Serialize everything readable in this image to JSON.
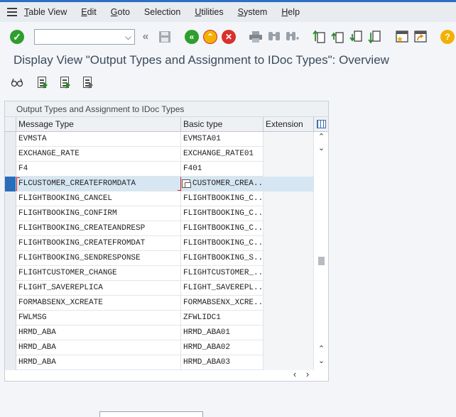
{
  "menubar": {
    "items": [
      {
        "label": "Table View",
        "key": "T",
        "rest": "able View"
      },
      {
        "label": "Edit",
        "key": "E",
        "rest": "dit"
      },
      {
        "label": "Goto",
        "key": "G",
        "rest": "oto"
      },
      {
        "label": "Selection",
        "key": "",
        "rest": "Selection"
      },
      {
        "label": "Utilities",
        "key": "U",
        "rest": "tilities"
      },
      {
        "label": "System",
        "key": "S",
        "rest": "ystem"
      },
      {
        "label": "Help",
        "key": "H",
        "rest": "elp"
      }
    ]
  },
  "toolbar": {
    "command_field_value": "",
    "dropdown_glyph": "⌵",
    "ok_glyph": "✓",
    "back_glyph": "«",
    "save_glyph": "🖫",
    "back2_glyph": "«",
    "exit_glyph": "⌃",
    "cancel_glyph": "✕",
    "print_glyph": "⎙",
    "find_glyph": "⚲",
    "find_next_glyph": "⚲",
    "help_glyph": "?"
  },
  "title": "Display View \"Output Types and Assignment to IDoc Types\": Overview",
  "table": {
    "title": "Output Types and Assignment to IDoc Types",
    "columns": {
      "message_type": "Message Type",
      "basic_type": "Basic type",
      "extension": "Extension"
    },
    "rows": [
      {
        "message_type": "EVMSTA",
        "basic_type": "EVMSTA01",
        "extension": ""
      },
      {
        "message_type": "EXCHANGE_RATE",
        "basic_type": "EXCHANGE_RATE01",
        "extension": ""
      },
      {
        "message_type": "F4",
        "basic_type": "F401",
        "extension": ""
      },
      {
        "message_type": "FLCUSTOMER_CREATEFROMDATA",
        "basic_type": "CUSTOMER_CREA...",
        "extension": "",
        "selected": true
      },
      {
        "message_type": "FLIGHTBOOKING_CANCEL",
        "basic_type": "FLIGHTBOOKING_C...",
        "extension": ""
      },
      {
        "message_type": "FLIGHTBOOKING_CONFIRM",
        "basic_type": "FLIGHTBOOKING_C...",
        "extension": ""
      },
      {
        "message_type": "FLIGHTBOOKING_CREATEANDRESP",
        "basic_type": "FLIGHTBOOKING_C...",
        "extension": ""
      },
      {
        "message_type": "FLIGHTBOOKING_CREATEFROMDAT",
        "basic_type": "FLIGHTBOOKING_C...",
        "extension": ""
      },
      {
        "message_type": "FLIGHTBOOKING_SENDRESPONSE",
        "basic_type": "FLIGHTBOOKING_S...",
        "extension": ""
      },
      {
        "message_type": "FLIGHTCUSTOMER_CHANGE",
        "basic_type": "FLIGHTCUSTOMER_...",
        "extension": ""
      },
      {
        "message_type": "FLIGHT_SAVEREPLICA",
        "basic_type": "FLIGHT_SAVEREPL...",
        "extension": ""
      },
      {
        "message_type": "FORMABSENX_XCREATE",
        "basic_type": "FORMABSENX_XCRE...",
        "extension": ""
      },
      {
        "message_type": "FWLMSG",
        "basic_type": "ZFWLIDC1",
        "extension": ""
      },
      {
        "message_type": "HRMD_ABA",
        "basic_type": "HRMD_ABA01",
        "extension": ""
      },
      {
        "message_type": "HRMD_ABA",
        "basic_type": "HRMD_ABA02",
        "extension": ""
      },
      {
        "message_type": "HRMD_ABA",
        "basic_type": "HRMD_ABA03",
        "extension": ""
      }
    ]
  },
  "scroll": {
    "up": "⌃",
    "down": "⌄",
    "left": "‹",
    "right": "›"
  },
  "colors": {
    "accent": "#2a71c4",
    "ok_green": "#2e9e2e",
    "cancel_red": "#d9302c",
    "exit_yellow": "#f2b100",
    "selection": "#d6e6f3"
  }
}
